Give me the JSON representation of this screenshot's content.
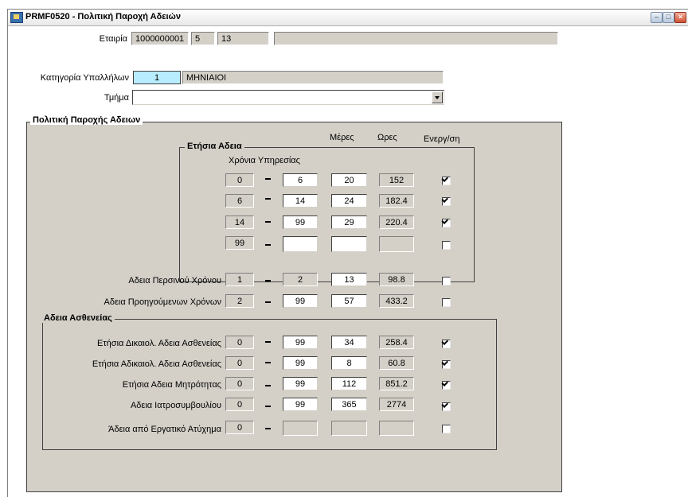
{
  "window": {
    "title": "PRMF0520 - Πολιτική Παροχή Αδειών",
    "controls": {
      "minimize": "–",
      "maximize": "□",
      "close": "×"
    }
  },
  "header": {
    "company_label": "Εταιρία",
    "company_code": "1000000001",
    "company_f2": "5",
    "company_f3": "13",
    "company_name": "",
    "category_label": "Κατηγορία Υπαλλήλων",
    "category_code": "1",
    "category_name": "ΜΗΝΙΑΙΟΙ",
    "dept_label": "Τμήμα",
    "dept_value": ""
  },
  "policy": {
    "frame_title": "Πολιτική Παροχής Αδειων",
    "col_days": "Μέρες",
    "col_hours": "Ωρες",
    "col_active": "Ενεργ/ση",
    "annual": {
      "title": "Ετήσια Αδεια",
      "years_header": "Χρόνια Υπηρεσίας",
      "rows": [
        {
          "from": "0",
          "to": "6",
          "days": "20",
          "hours": "152",
          "active": true
        },
        {
          "from": "6",
          "to": "14",
          "days": "24",
          "hours": "182.4",
          "active": true
        },
        {
          "from": "14",
          "to": "99",
          "days": "29",
          "hours": "220.4",
          "active": true
        },
        {
          "from": "99",
          "to": "",
          "days": "",
          "hours": "",
          "active": false
        }
      ]
    },
    "other": [
      {
        "label": "Αδεια Περσινού Χρόνου",
        "from": "1",
        "to": "2",
        "days": "13",
        "hours": "98.8",
        "active": false
      },
      {
        "label": "Αδεια Προηγούμενων Χρόνων",
        "from": "2",
        "to": "99",
        "days": "57",
        "hours": "433.2",
        "active": false
      }
    ],
    "sick": {
      "title": "Αδεια Ασθενείας",
      "rows": [
        {
          "label": "Ετήσια Δικαιολ. Αδεια Ασθενείας",
          "from": "0",
          "to": "99",
          "days": "34",
          "hours": "258.4",
          "active": true
        },
        {
          "label": "Ετήσια Αδικαιολ. Αδεια Ασθενείας",
          "from": "0",
          "to": "99",
          "days": "8",
          "hours": "60.8",
          "active": true
        },
        {
          "label": "Ετήσια Αδεια Μητρότητας",
          "from": "0",
          "to": "99",
          "days": "112",
          "hours": "851.2",
          "active": true
        },
        {
          "label": "Αδεια Ιατροσυμβουλίου",
          "from": "0",
          "to": "99",
          "days": "365",
          "hours": "2774",
          "active": true
        },
        {
          "label": "Άδεια από Εργατικό Ατύχημα",
          "from": "0",
          "to": "",
          "days": "",
          "hours": "",
          "active": false
        }
      ]
    }
  }
}
